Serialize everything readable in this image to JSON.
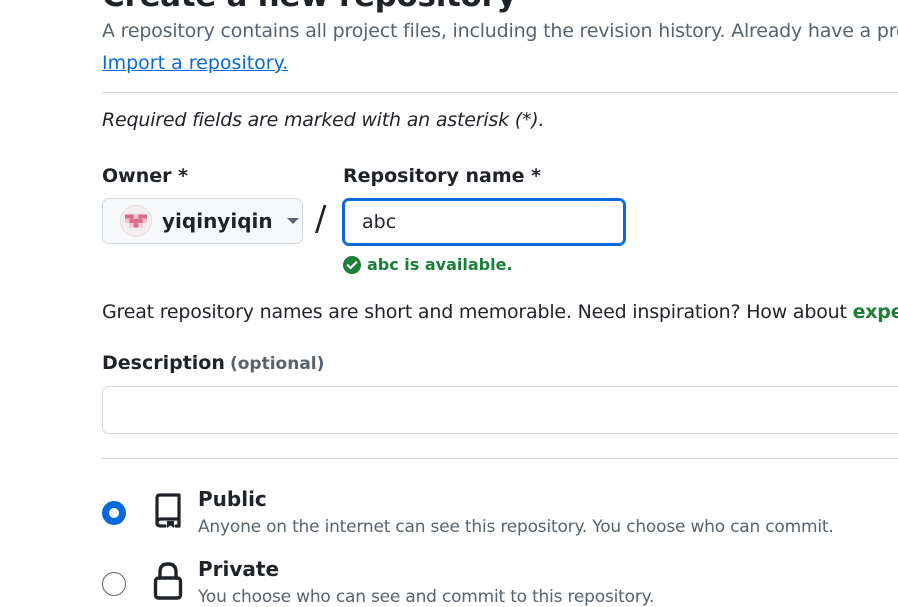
{
  "page": {
    "title": "Create a new repository",
    "intro": "A repository contains all project files, including the revision history. Already have a pro",
    "import_link": "Import a repository.",
    "required_note": "Required fields are marked with an asterisk (*)."
  },
  "owner": {
    "label": "Owner *",
    "name": "yiqinyiqin",
    "avatar_color": "#d86a8a"
  },
  "separator": "/",
  "repository": {
    "label": "Repository name *",
    "value": "abc",
    "availability": "abc is available.",
    "status_color": "#1a7f37"
  },
  "suggestion": {
    "text": "Great repository names are short and memorable. Need inspiration? How about ",
    "link": "exper"
  },
  "description": {
    "label": "Description",
    "optional": "(optional)",
    "value": ""
  },
  "visibility": [
    {
      "label": "Public",
      "description": "Anyone on the internet can see this repository. You choose who can commit.",
      "icon": "repo-icon",
      "selected": true
    },
    {
      "label": "Private",
      "description": "You choose who can see and commit to this repository.",
      "icon": "lock-icon",
      "selected": false
    }
  ],
  "colors": {
    "accent": "#0969da",
    "success": "#1a7f37",
    "text": "#1f2328",
    "muted": "#59636e",
    "border": "#d1d9e0"
  }
}
